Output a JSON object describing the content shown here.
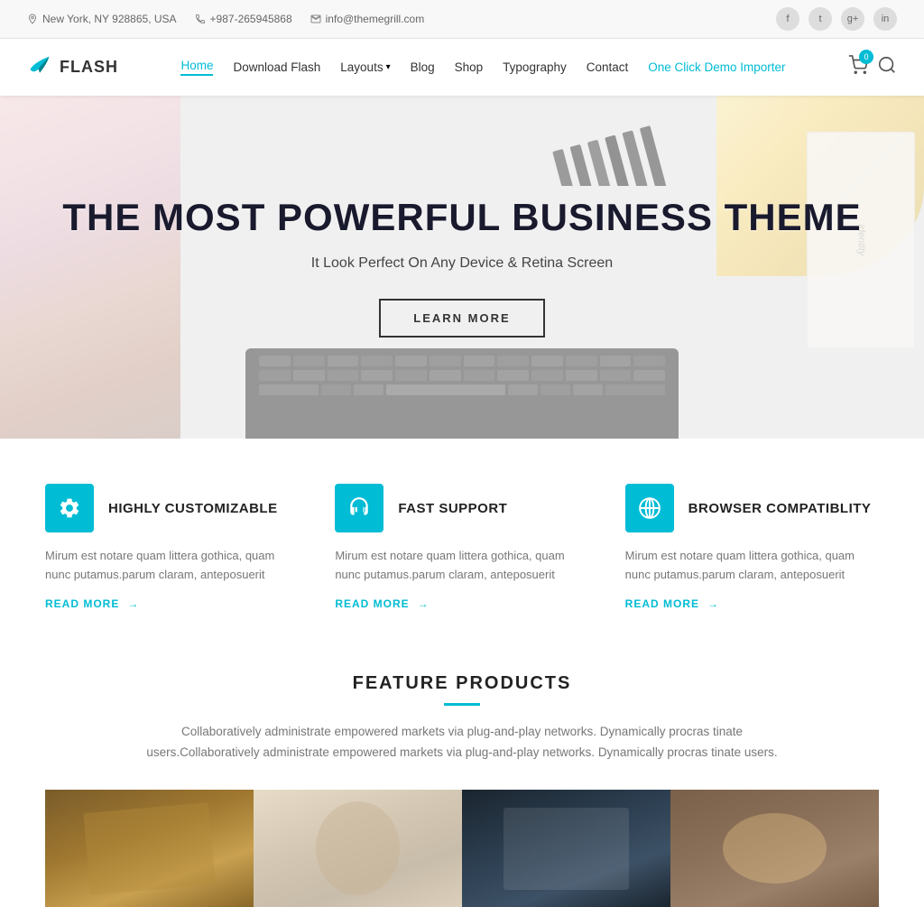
{
  "topBar": {
    "location": "New York, NY 928865, USA",
    "phone": "+987-265945868",
    "email": "info@themegrill.com",
    "socials": [
      "f",
      "t",
      "g+",
      "in"
    ]
  },
  "header": {
    "logo_text": "FLASH",
    "nav": {
      "home": "Home",
      "download": "Download Flash",
      "layouts": "Layouts",
      "blog": "Blog",
      "shop": "Shop",
      "typography": "Typography",
      "contact": "Contact",
      "demo": "One Click Demo Importer"
    },
    "cart_count": "0"
  },
  "hero": {
    "title": "THE MOST POWERFUL BUSINESS THEME",
    "subtitle": "It Look Perfect On Any Device & Retina Screen",
    "button": "LEARN MORE"
  },
  "features": [
    {
      "title": "HIGHLY CUSTOMIZABLE",
      "icon": "gear",
      "text": "Mirum est notare quam littera gothica, quam nunc putamus.parum claram, anteposuerit",
      "read_more": "READ MORE"
    },
    {
      "title": "FAST SUPPORT",
      "icon": "headset",
      "text": "Mirum est notare quam littera gothica, quam nunc putamus.parum claram, anteposuerit",
      "read_more": "READ MORE"
    },
    {
      "title": "BROWSER COMPATIBLITY",
      "icon": "globe",
      "text": "Mirum est notare quam littera gothica, quam nunc putamus.parum claram, anteposuerit",
      "read_more": "READ MORE"
    }
  ],
  "productsSection": {
    "title": "FEATURE PRODUCTS",
    "desc": "Collaboratively administrate empowered markets via plug-and-play networks. Dynamically procras tinate users.Collaboratively administrate empowered markets via plug-and-play networks. Dynamically procras tinate users."
  },
  "colors": {
    "accent": "#00bcd4"
  }
}
